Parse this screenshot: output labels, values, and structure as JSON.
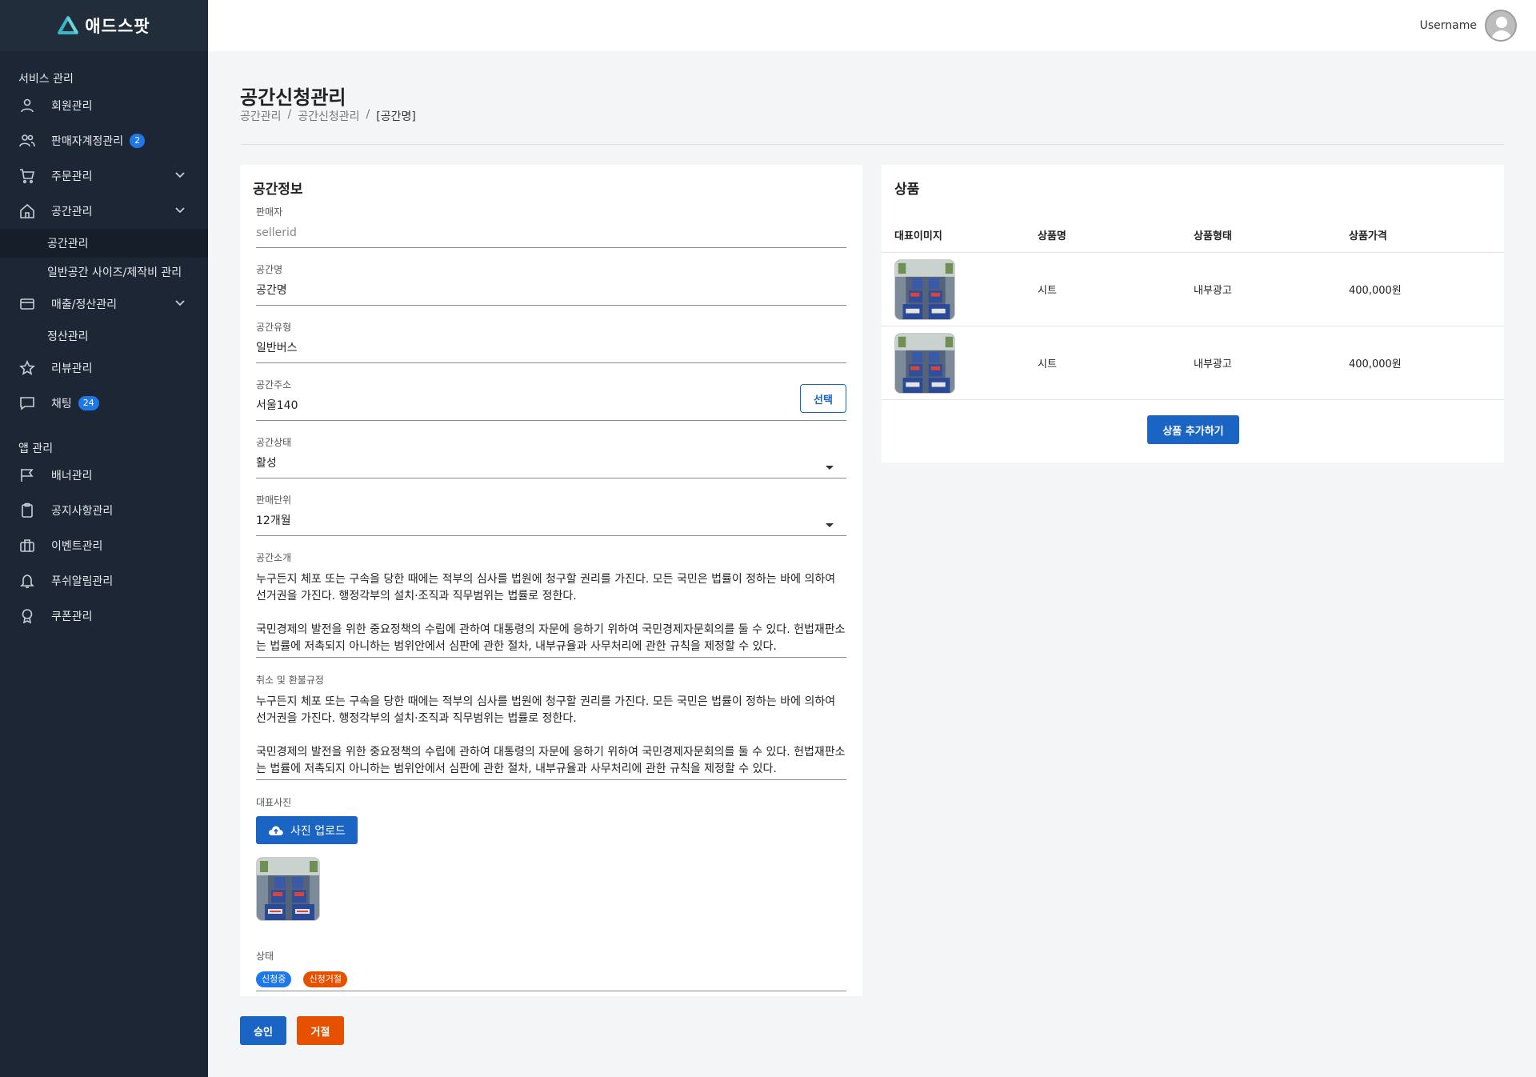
{
  "app": {
    "logo_text": "애드스팟",
    "user_name": "Username"
  },
  "sidebar": {
    "section1": "서비스 관리",
    "section2": "앱 관리",
    "items": {
      "members": "회원관리",
      "sellers": "판매자계정관리",
      "sellers_badge": "2",
      "orders": "주문관리",
      "spaces": "공간관리",
      "space_apply": "공간관리",
      "space_size": "일반공간 사이즈/제작비 관리",
      "sales": "매출/정산관리",
      "settlement": "정산관리",
      "reviews": "리뷰관리",
      "chat": "채팅",
      "chat_badge": "24",
      "banners": "배너관리",
      "notices": "공지사항관리",
      "events": "이벤트관리",
      "push": "푸쉬알림관리",
      "coupons": "쿠폰관리"
    }
  },
  "page": {
    "title": "공간신청관리",
    "breadcrumb": [
      "공간관리",
      "공간신청관리",
      "[공간명]"
    ],
    "sep": "/"
  },
  "space_info": {
    "title": "공간정보",
    "seller": {
      "label": "판매자",
      "value": "sellerid"
    },
    "name": {
      "label": "공간명",
      "value": "공간명"
    },
    "type": {
      "label": "공간유형",
      "value": "일반버스"
    },
    "address": {
      "label": "공간주소",
      "value": "서울140",
      "button": "선택"
    },
    "status_select": {
      "label": "공간상태",
      "value": "활성"
    },
    "unit": {
      "label": "판매단위",
      "value": "12개월"
    },
    "intro": {
      "label": "공간소개",
      "p1": "누구든지 체포 또는 구속을 당한 때에는 적부의 심사를 법원에 청구할 권리를 가진다. 모든 국민은 법률이 정하는 바에 의하여 선거권을 가진다. 행정각부의 설치·조직과 직무범위는 법률로 정한다.",
      "p2": "국민경제의 발전을 위한 중요정책의 수립에 관하여 대통령의 자문에 응하기 위하여 국민경제자문회의를 둘 수 있다. 헌법재판소는 법률에 저촉되지 아니하는 범위안에서 심판에 관한 절차, 내부규율과 사무처리에 관한 규칙을 제정할 수 있다."
    },
    "refund": {
      "label": "취소 및 환불규정",
      "p1": "누구든지 체포 또는 구속을 당한 때에는 적부의 심사를 법원에 청구할 권리를 가진다. 모든 국민은 법률이 정하는 바에 의하여 선거권을 가진다. 행정각부의 설치·조직과 직무범위는 법률로 정한다.",
      "p2": "국민경제의 발전을 위한 중요정책의 수립에 관하여 대통령의 자문에 응하기 위하여 국민경제자문회의를 둘 수 있다. 헌법재판소는 법률에 저촉되지 아니하는 범위안에서 심판에 관한 절차, 내부규율과 사무처리에 관한 규칙을 제정할 수 있다."
    },
    "photo": {
      "label": "대표사진",
      "button": "사진 업로드"
    },
    "state": {
      "label": "상태",
      "chip1": "신청중",
      "chip2": "신청거절"
    }
  },
  "products": {
    "title": "상품",
    "headers": [
      "대표이미지",
      "상품명",
      "상품형태",
      "상품가격"
    ],
    "rows": [
      {
        "name": "시트",
        "type": "내부광고",
        "price": "400,000원"
      },
      {
        "name": "시트",
        "type": "내부광고",
        "price": "400,000원"
      }
    ],
    "add_button": "상품 추가하기"
  },
  "actions": {
    "approve": "승인",
    "reject": "거절"
  },
  "colors": {
    "sidebar_bg": "#1d2634",
    "primary": "#1a64c4",
    "danger": "#e65100",
    "badge": "#1f78e8"
  }
}
